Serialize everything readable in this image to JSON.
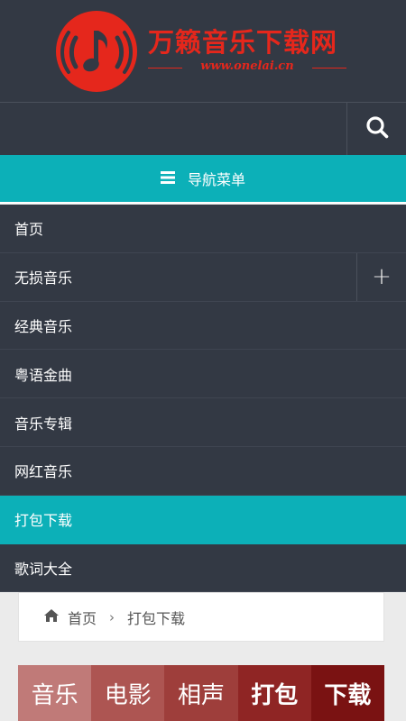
{
  "header": {
    "logo_title": "万籁音乐下载网",
    "logo_url": "www.onelai.cn",
    "logo_icon": "music-note-icon",
    "brand_color": "#e5271c"
  },
  "search": {
    "placeholder": "",
    "icon": "search-icon"
  },
  "nav": {
    "toggle_label": "导航菜单",
    "toggle_icon": "menu-icon",
    "accent_color": "#0cb0b8",
    "items": [
      {
        "label": "首页",
        "active": false
      },
      {
        "label": "无损音乐",
        "active": false,
        "expand": "+"
      },
      {
        "label": "经典音乐",
        "active": false
      },
      {
        "label": "粤语金曲",
        "active": false
      },
      {
        "label": "音乐专辑",
        "active": false
      },
      {
        "label": "网红音乐",
        "active": false
      },
      {
        "label": "打包下载",
        "active": true
      },
      {
        "label": "歌词大全",
        "active": false
      }
    ]
  },
  "breadcrumb": {
    "home_label": "首页",
    "separator": "›",
    "current": "打包下载"
  },
  "banner": {
    "cells": [
      {
        "label": "音乐",
        "color": "#c07a78"
      },
      {
        "label": "电影",
        "color": "#ad5552"
      },
      {
        "label": "相声",
        "color": "#9e3e3b"
      },
      {
        "label": "打包",
        "color": "#8f2524"
      },
      {
        "label": "下载",
        "color": "#7a1212"
      }
    ]
  }
}
